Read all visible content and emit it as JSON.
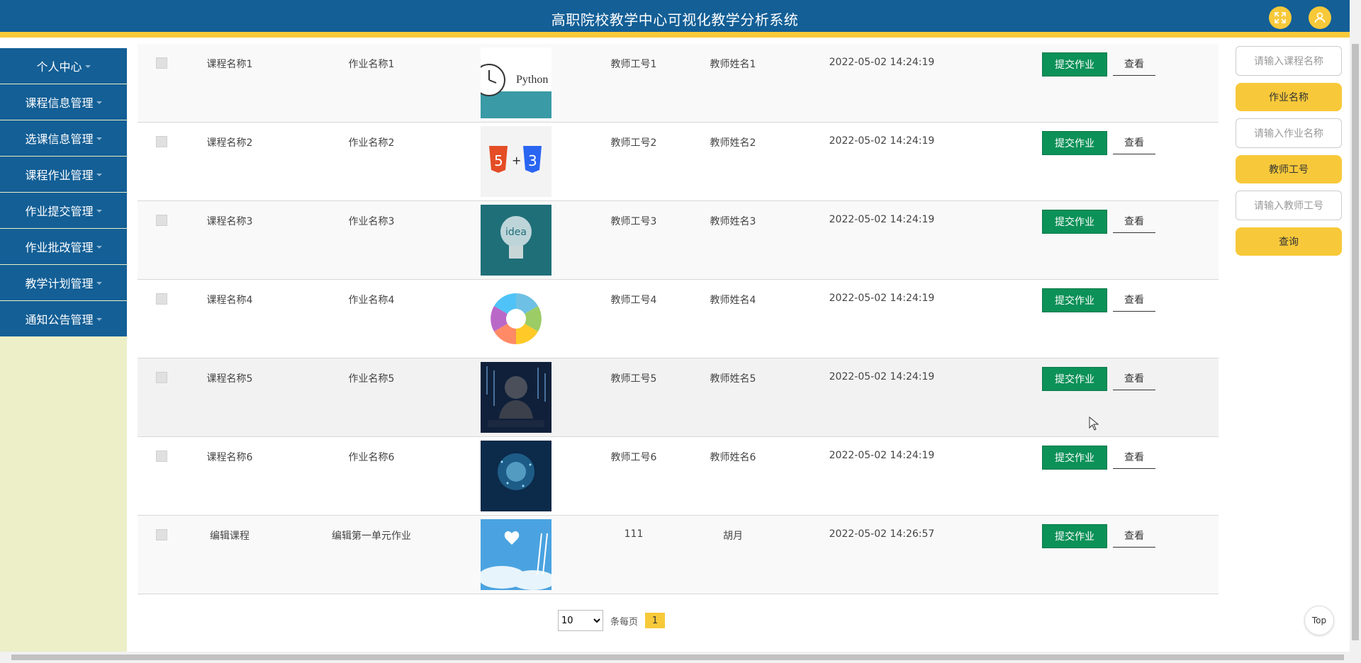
{
  "header": {
    "title": "高职院校教学中心可视化教学分析系统"
  },
  "sidebar": {
    "items": [
      {
        "label": "个人中心"
      },
      {
        "label": "课程信息管理"
      },
      {
        "label": "选课信息管理"
      },
      {
        "label": "课程作业管理"
      },
      {
        "label": "作业提交管理"
      },
      {
        "label": "作业批改管理"
      },
      {
        "label": "教学计划管理"
      },
      {
        "label": "通知公告管理"
      }
    ]
  },
  "table": {
    "submit_label": "提交作业",
    "view_label": "查看",
    "rows": [
      {
        "course": "课程名称1",
        "homework": "作业名称1",
        "teacher_id": "教师工号1",
        "teacher_name": "教师姓名1",
        "time": "2022-05-02 14:24:19",
        "image_text": "Python"
      },
      {
        "course": "课程名称2",
        "homework": "作业名称2",
        "teacher_id": "教师工号2",
        "teacher_name": "教师姓名2",
        "time": "2022-05-02 14:24:19",
        "image_text": ""
      },
      {
        "course": "课程名称3",
        "homework": "作业名称3",
        "teacher_id": "教师工号3",
        "teacher_name": "教师姓名3",
        "time": "2022-05-02 14:24:19",
        "image_text": "idea"
      },
      {
        "course": "课程名称4",
        "homework": "作业名称4",
        "teacher_id": "教师工号4",
        "teacher_name": "教师姓名4",
        "time": "2022-05-02 14:24:19",
        "image_text": ""
      },
      {
        "course": "课程名称5",
        "homework": "作业名称5",
        "teacher_id": "教师工号5",
        "teacher_name": "教师姓名5",
        "time": "2022-05-02 14:24:19",
        "image_text": ""
      },
      {
        "course": "课程名称6",
        "homework": "作业名称6",
        "teacher_id": "教师工号6",
        "teacher_name": "教师姓名6",
        "time": "2022-05-02 14:24:19",
        "image_text": ""
      },
      {
        "course": "编辑课程",
        "homework": "编辑第一单元作业",
        "teacher_id": "111",
        "teacher_name": "胡月",
        "time": "2022-05-02 14:26:57",
        "image_text": ""
      }
    ]
  },
  "pagination": {
    "page_size": "10",
    "per_page_label": "条每页",
    "current_page": "1"
  },
  "filter": {
    "course_placeholder": "请输入课程名称",
    "homework_label": "作业名称",
    "homework_placeholder": "请输入作业名称",
    "teacher_label": "教师工号",
    "teacher_placeholder": "请输入教师工号",
    "search_label": "查询"
  },
  "top_label": "Top",
  "colors": {
    "primary": "#135f96",
    "accent": "#f7c93a",
    "submit": "#0c9158",
    "sidebar_bg": "#ecefc7"
  }
}
